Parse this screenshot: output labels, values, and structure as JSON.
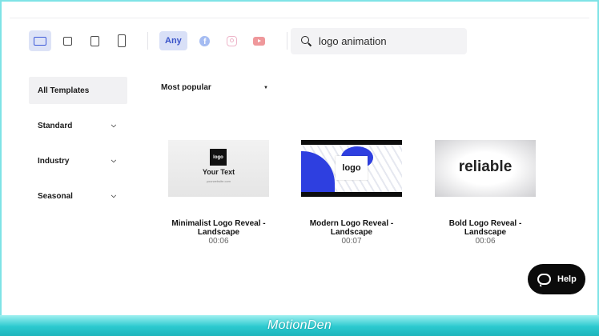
{
  "search": {
    "value": "logo animation"
  },
  "filters": {
    "aspect_ratios": [
      "landscape",
      "square",
      "portrait",
      "vertical"
    ],
    "platform_any_label": "Any",
    "platform_icons": [
      "facebook-icon",
      "instagram-icon",
      "youtube-icon"
    ]
  },
  "sidebar": {
    "items": [
      {
        "label": "All Templates",
        "active": true
      },
      {
        "label": "Standard"
      },
      {
        "label": "Industry"
      },
      {
        "label": "Seasonal"
      }
    ]
  },
  "sort": {
    "label": "Most popular"
  },
  "templates": [
    {
      "title_line1": "Minimalist Logo Reveal -",
      "title_line2": "Landscape",
      "duration": "00:06",
      "thumb_logo": "logo",
      "thumb_text": "Your Text",
      "thumb_url": "yourwebsite.com"
    },
    {
      "title_line1": "Modern Logo Reveal -",
      "title_line2": "Landscape",
      "duration": "00:07",
      "thumb_logo": "logo"
    },
    {
      "title_line1": "Bold Logo Reveal -",
      "title_line2": "Landscape",
      "duration": "00:06",
      "thumb_text": "reliable"
    }
  ],
  "help": {
    "label": "Help"
  },
  "watermark": {
    "text": "MotionDen"
  },
  "colors": {
    "accent": "#3f5bd9",
    "watermark_bar": "#2bc9cf",
    "help_bg": "#0b0b0b"
  }
}
